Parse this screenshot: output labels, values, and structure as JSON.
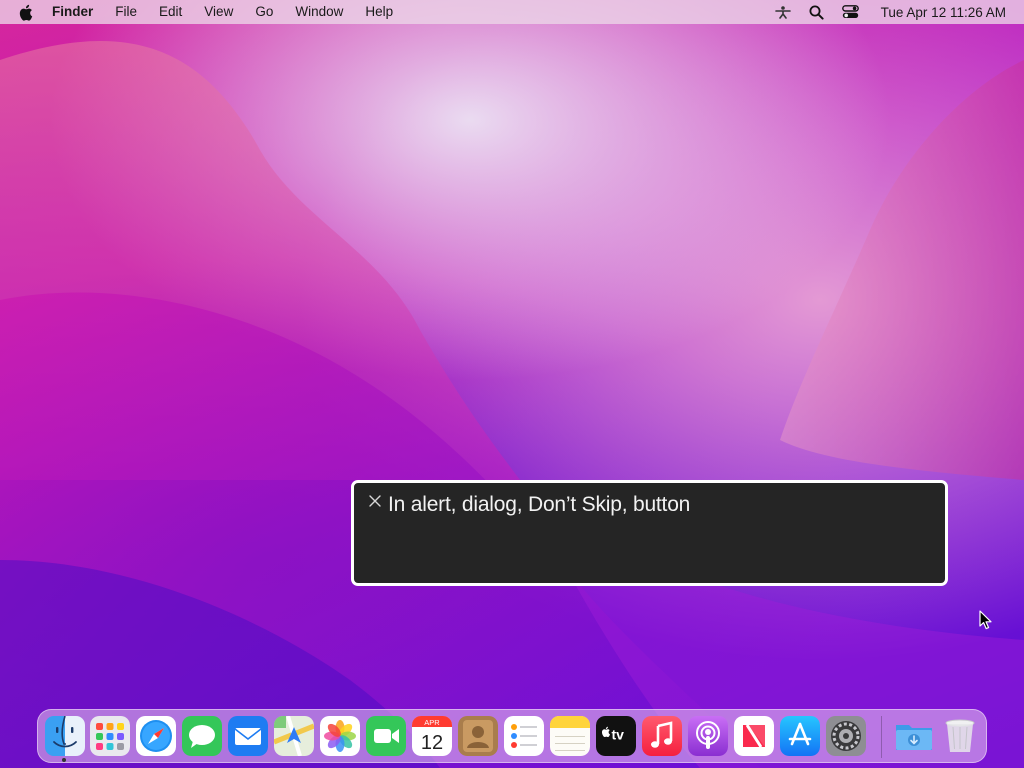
{
  "menubar": {
    "apple_icon": "apple-logo-icon",
    "app_name": "Finder",
    "menus": [
      "File",
      "Edit",
      "View",
      "Go",
      "Window",
      "Help"
    ],
    "status_icons": [
      "voiceover-icon",
      "spotlight-search-icon",
      "control-center-icon"
    ],
    "clock": "Tue Apr 12  11:26 AM"
  },
  "caption_panel": {
    "text": "In alert, dialog, Don’t Skip, button",
    "close_icon": "close-icon"
  },
  "dock": {
    "apps": [
      {
        "name": "Finder",
        "icon": "finder-icon",
        "running": true
      },
      {
        "name": "Launchpad",
        "icon": "launchpad-icon"
      },
      {
        "name": "Safari",
        "icon": "safari-icon"
      },
      {
        "name": "Messages",
        "icon": "messages-icon"
      },
      {
        "name": "Mail",
        "icon": "mail-icon"
      },
      {
        "name": "Maps",
        "icon": "maps-icon"
      },
      {
        "name": "Photos",
        "icon": "photos-icon"
      },
      {
        "name": "FaceTime",
        "icon": "facetime-icon"
      },
      {
        "name": "Calendar",
        "icon": "calendar-icon",
        "month": "APR",
        "day": "12"
      },
      {
        "name": "Contacts",
        "icon": "contacts-icon"
      },
      {
        "name": "Reminders",
        "icon": "reminders-icon"
      },
      {
        "name": "Notes",
        "icon": "notes-icon"
      },
      {
        "name": "TV",
        "icon": "apple-tv-icon",
        "label": "tv"
      },
      {
        "name": "Music",
        "icon": "music-icon"
      },
      {
        "name": "Podcasts",
        "icon": "podcasts-icon"
      },
      {
        "name": "News",
        "icon": "news-icon"
      },
      {
        "name": "App Store",
        "icon": "app-store-icon"
      },
      {
        "name": "System Preferences",
        "icon": "system-preferences-icon"
      }
    ],
    "others": [
      {
        "name": "Downloads",
        "icon": "downloads-folder-icon"
      },
      {
        "name": "Trash",
        "icon": "trash-icon"
      }
    ]
  },
  "colors": {
    "menubar_bg": "#ecd6e8",
    "caption_bg": "#252525",
    "caption_border": "#ffffff",
    "wallpaper_pink": "#d92a9a",
    "wallpaper_purple": "#5a0ed2"
  }
}
